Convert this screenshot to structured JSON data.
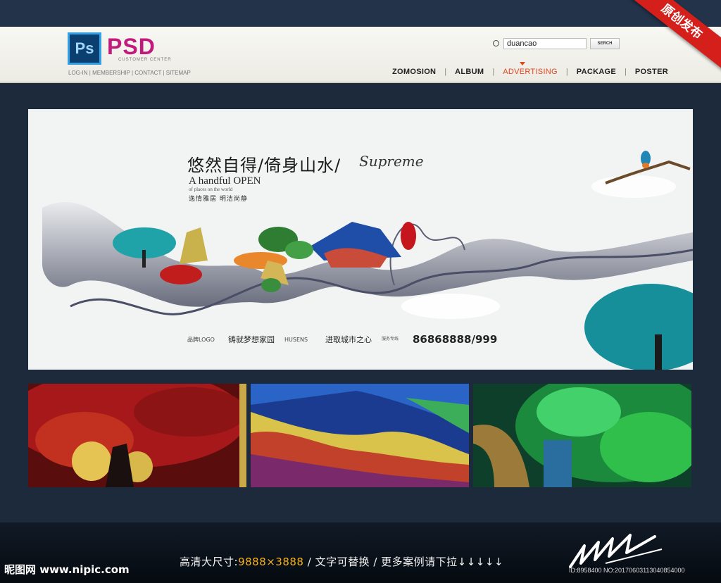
{
  "ribbon": {
    "label": "原创发布"
  },
  "header": {
    "logo_mark": "Ps",
    "logo_title": "PSD",
    "logo_subtitle": "CUSTOMER CENTER",
    "top_links": [
      "LOG-IN",
      "MEMBERSHIP",
      "CONTACT",
      "SITEMAP"
    ],
    "search": {
      "value": "duancao",
      "button_label": "SERCH"
    },
    "nav": [
      {
        "label": "ZOMOSION",
        "active": false
      },
      {
        "label": "ALBUM",
        "active": false
      },
      {
        "label": "ADVERTISING",
        "active": true
      },
      {
        "label": "PACKAGE",
        "active": false
      },
      {
        "label": "POSTER",
        "active": false
      }
    ]
  },
  "banner": {
    "headline": "悠然自得/倚身山水/",
    "script": "Supreme",
    "subtitle": "A handful OPEN",
    "places_line": "of places on the world",
    "tagline": "逸情雅居 明洁尚静",
    "footer": {
      "brand_logo": "品牌LOGO",
      "slogan_1": "铸就梦想家园",
      "brand_2": "HUSENS",
      "slogan_2": "进取城市之心",
      "hotline_label": "服务专线",
      "phone": "86868888/999"
    }
  },
  "colors": {
    "accent": "#e2451b",
    "brand": "#c2197d",
    "ribbon": "#d51f1a",
    "highlight": "#f7b21f"
  },
  "footer": {
    "site_logo": "昵图网 www.nipic.com",
    "caption_prefix": "高清大尺寸:",
    "caption_size": "9888×3888",
    "caption_rest": " / 文字可替换 / 更多案例请下拉↓↓↓↓↓",
    "id_line": "ID:8958400 NO:20170603113040854000"
  }
}
